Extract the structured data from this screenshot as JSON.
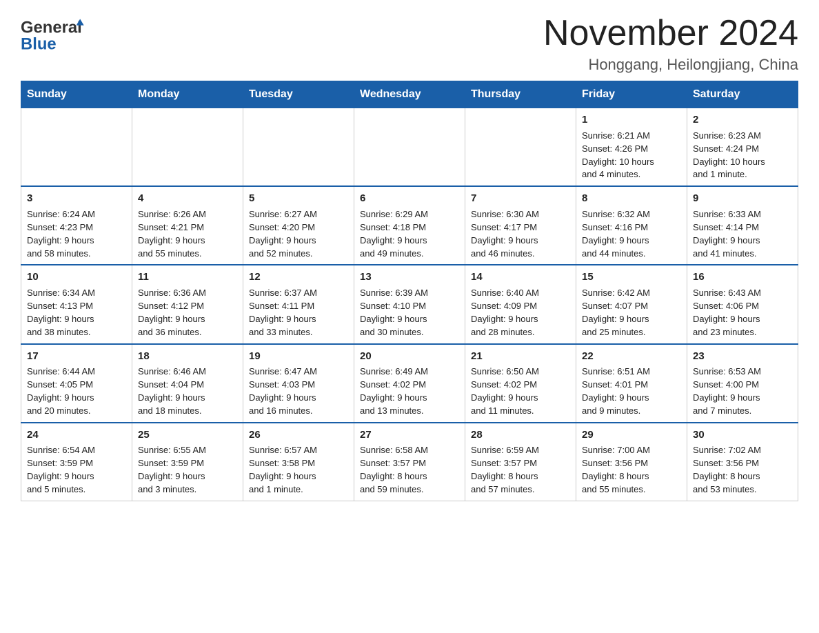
{
  "header": {
    "logo_text_black": "General",
    "logo_text_blue": "Blue",
    "month_title": "November 2024",
    "location": "Honggang, Heilongjiang, China"
  },
  "days_of_week": [
    "Sunday",
    "Monday",
    "Tuesday",
    "Wednesday",
    "Thursday",
    "Friday",
    "Saturday"
  ],
  "weeks": [
    [
      {
        "day": "",
        "info": ""
      },
      {
        "day": "",
        "info": ""
      },
      {
        "day": "",
        "info": ""
      },
      {
        "day": "",
        "info": ""
      },
      {
        "day": "",
        "info": ""
      },
      {
        "day": "1",
        "info": "Sunrise: 6:21 AM\nSunset: 4:26 PM\nDaylight: 10 hours\nand 4 minutes."
      },
      {
        "day": "2",
        "info": "Sunrise: 6:23 AM\nSunset: 4:24 PM\nDaylight: 10 hours\nand 1 minute."
      }
    ],
    [
      {
        "day": "3",
        "info": "Sunrise: 6:24 AM\nSunset: 4:23 PM\nDaylight: 9 hours\nand 58 minutes."
      },
      {
        "day": "4",
        "info": "Sunrise: 6:26 AM\nSunset: 4:21 PM\nDaylight: 9 hours\nand 55 minutes."
      },
      {
        "day": "5",
        "info": "Sunrise: 6:27 AM\nSunset: 4:20 PM\nDaylight: 9 hours\nand 52 minutes."
      },
      {
        "day": "6",
        "info": "Sunrise: 6:29 AM\nSunset: 4:18 PM\nDaylight: 9 hours\nand 49 minutes."
      },
      {
        "day": "7",
        "info": "Sunrise: 6:30 AM\nSunset: 4:17 PM\nDaylight: 9 hours\nand 46 minutes."
      },
      {
        "day": "8",
        "info": "Sunrise: 6:32 AM\nSunset: 4:16 PM\nDaylight: 9 hours\nand 44 minutes."
      },
      {
        "day": "9",
        "info": "Sunrise: 6:33 AM\nSunset: 4:14 PM\nDaylight: 9 hours\nand 41 minutes."
      }
    ],
    [
      {
        "day": "10",
        "info": "Sunrise: 6:34 AM\nSunset: 4:13 PM\nDaylight: 9 hours\nand 38 minutes."
      },
      {
        "day": "11",
        "info": "Sunrise: 6:36 AM\nSunset: 4:12 PM\nDaylight: 9 hours\nand 36 minutes."
      },
      {
        "day": "12",
        "info": "Sunrise: 6:37 AM\nSunset: 4:11 PM\nDaylight: 9 hours\nand 33 minutes."
      },
      {
        "day": "13",
        "info": "Sunrise: 6:39 AM\nSunset: 4:10 PM\nDaylight: 9 hours\nand 30 minutes."
      },
      {
        "day": "14",
        "info": "Sunrise: 6:40 AM\nSunset: 4:09 PM\nDaylight: 9 hours\nand 28 minutes."
      },
      {
        "day": "15",
        "info": "Sunrise: 6:42 AM\nSunset: 4:07 PM\nDaylight: 9 hours\nand 25 minutes."
      },
      {
        "day": "16",
        "info": "Sunrise: 6:43 AM\nSunset: 4:06 PM\nDaylight: 9 hours\nand 23 minutes."
      }
    ],
    [
      {
        "day": "17",
        "info": "Sunrise: 6:44 AM\nSunset: 4:05 PM\nDaylight: 9 hours\nand 20 minutes."
      },
      {
        "day": "18",
        "info": "Sunrise: 6:46 AM\nSunset: 4:04 PM\nDaylight: 9 hours\nand 18 minutes."
      },
      {
        "day": "19",
        "info": "Sunrise: 6:47 AM\nSunset: 4:03 PM\nDaylight: 9 hours\nand 16 minutes."
      },
      {
        "day": "20",
        "info": "Sunrise: 6:49 AM\nSunset: 4:02 PM\nDaylight: 9 hours\nand 13 minutes."
      },
      {
        "day": "21",
        "info": "Sunrise: 6:50 AM\nSunset: 4:02 PM\nDaylight: 9 hours\nand 11 minutes."
      },
      {
        "day": "22",
        "info": "Sunrise: 6:51 AM\nSunset: 4:01 PM\nDaylight: 9 hours\nand 9 minutes."
      },
      {
        "day": "23",
        "info": "Sunrise: 6:53 AM\nSunset: 4:00 PM\nDaylight: 9 hours\nand 7 minutes."
      }
    ],
    [
      {
        "day": "24",
        "info": "Sunrise: 6:54 AM\nSunset: 3:59 PM\nDaylight: 9 hours\nand 5 minutes."
      },
      {
        "day": "25",
        "info": "Sunrise: 6:55 AM\nSunset: 3:59 PM\nDaylight: 9 hours\nand 3 minutes."
      },
      {
        "day": "26",
        "info": "Sunrise: 6:57 AM\nSunset: 3:58 PM\nDaylight: 9 hours\nand 1 minute."
      },
      {
        "day": "27",
        "info": "Sunrise: 6:58 AM\nSunset: 3:57 PM\nDaylight: 8 hours\nand 59 minutes."
      },
      {
        "day": "28",
        "info": "Sunrise: 6:59 AM\nSunset: 3:57 PM\nDaylight: 8 hours\nand 57 minutes."
      },
      {
        "day": "29",
        "info": "Sunrise: 7:00 AM\nSunset: 3:56 PM\nDaylight: 8 hours\nand 55 minutes."
      },
      {
        "day": "30",
        "info": "Sunrise: 7:02 AM\nSunset: 3:56 PM\nDaylight: 8 hours\nand 53 minutes."
      }
    ]
  ]
}
